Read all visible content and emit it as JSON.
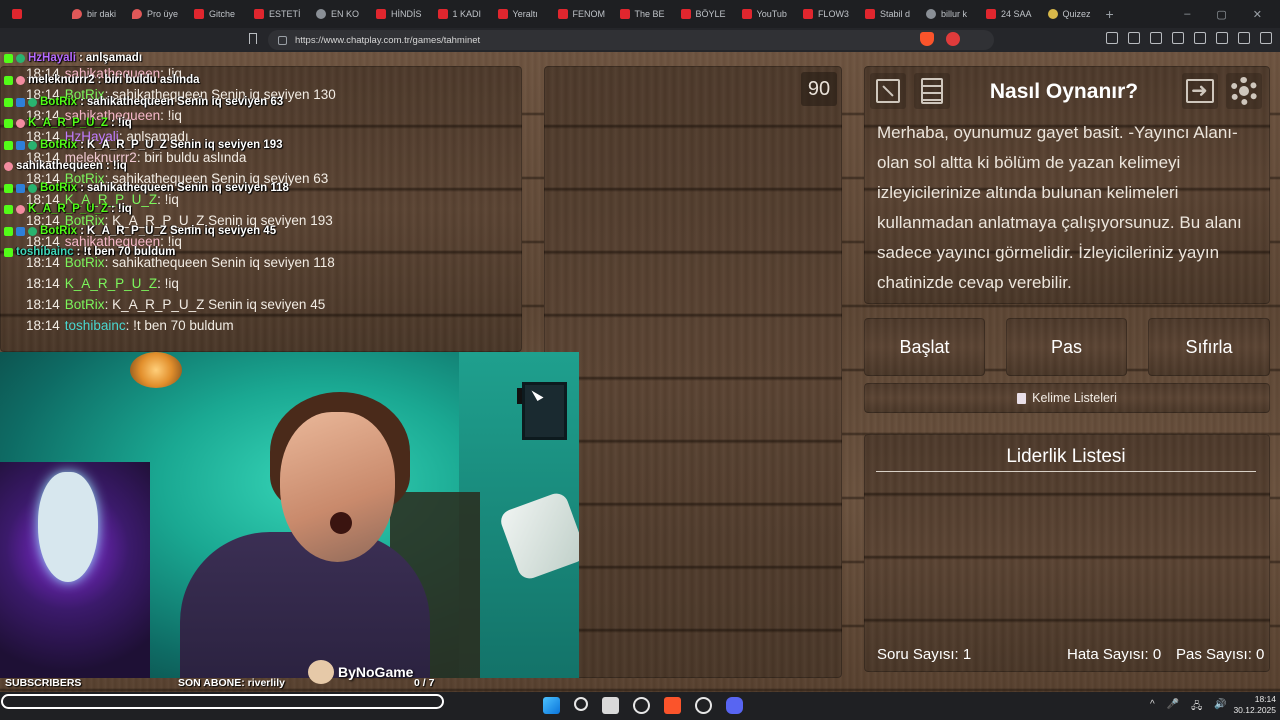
{
  "browser": {
    "tabs": [
      {
        "label": "",
        "icon": "kick-icon"
      },
      {
        "label": "bir daki",
        "icon": "pin-icon"
      },
      {
        "label": "Pro üye",
        "icon": "pin-icon"
      },
      {
        "label": "Gitche",
        "icon": "youtube-icon"
      },
      {
        "label": "ESTETİ",
        "icon": "youtube-icon"
      },
      {
        "label": "EN KO",
        "icon": "openai-icon"
      },
      {
        "label": "HİNDİS",
        "icon": "youtube-icon"
      },
      {
        "label": "1 KADI",
        "icon": "youtube-icon"
      },
      {
        "label": "Yeraltı",
        "icon": "youtube-icon"
      },
      {
        "label": "FENOM",
        "icon": "youtube-icon"
      },
      {
        "label": "The BE",
        "icon": "youtube-icon"
      },
      {
        "label": "BÖYLE",
        "icon": "youtube-icon"
      },
      {
        "label": "YouTub",
        "icon": "youtube-icon"
      },
      {
        "label": "FLOW3",
        "icon": "youtube-icon"
      },
      {
        "label": "Stabil d",
        "icon": "youtube-icon"
      },
      {
        "label": "billur k",
        "icon": "openai-icon"
      },
      {
        "label": "24 SAA",
        "icon": "youtube-icon"
      },
      {
        "label": "Quizez",
        "icon": "quiz-icon"
      }
    ],
    "new_tab": "+",
    "window_controls": [
      "–",
      "▢",
      "✕"
    ],
    "url": "https://www.chatplay.com.tr/games/tahminet"
  },
  "stream_overlay_chat": [
    {
      "user": "HzHayali",
      "message": "anlşamadı",
      "user_color": "purple",
      "badges": [
        "kick",
        "mod"
      ]
    },
    {
      "user": "meleknurrr2",
      "message": "biri buldu aslında",
      "user_color": "white",
      "badges": [
        "kick",
        "pink"
      ]
    },
    {
      "user": "BotRix",
      "message": "sahikathequeen Senin iq seviyen 63",
      "user_color": "green",
      "badges": [
        "kick",
        "blue",
        "mod"
      ]
    },
    {
      "user": "K_A_R_P_U_Z",
      "message": "!iq",
      "user_color": "green",
      "badges": [
        "kick",
        "pink"
      ]
    },
    {
      "user": "BotRix",
      "message": "K_A_R_P_U_Z Senin iq seviyen 193",
      "user_color": "green",
      "badges": [
        "kick",
        "blue",
        "mod"
      ]
    },
    {
      "user": "sahikathequeen",
      "message": "!iq",
      "user_color": "white",
      "badges": [
        "pink"
      ]
    },
    {
      "user": "BotRix",
      "message": "sahikathequeen Senin iq seviyen 118",
      "user_color": "green",
      "badges": [
        "kick",
        "blue",
        "mod"
      ]
    },
    {
      "user": "K_A_R_P_U_Z",
      "message": "!iq",
      "user_color": "green",
      "badges": [
        "kick",
        "pink"
      ]
    },
    {
      "user": "BotRix",
      "message": "K_A_R_P_U_Z Senin iq seviyen 45",
      "user_color": "green",
      "badges": [
        "kick",
        "blue",
        "mod"
      ]
    },
    {
      "user": "toshibainc",
      "message": "!t ben 70 buldum",
      "user_color": "teal",
      "badges": [
        "kick"
      ]
    }
  ],
  "game_chat": [
    {
      "time": "18:14",
      "user": "sahikathequeen",
      "message": "!iq",
      "color": "pink"
    },
    {
      "time": "18:14",
      "user": "BotRix",
      "message": "sahikathequeen Senin iq seviyen 130",
      "color": "green"
    },
    {
      "time": "18:14",
      "user": "sahikathequeen",
      "message": "!iq",
      "color": "pink"
    },
    {
      "time": "18:14",
      "user": "HzHayali",
      "message": "anlşamadı",
      "color": "purple"
    },
    {
      "time": "18:14",
      "user": "meleknurrr2",
      "message": "biri buldu aslında",
      "color": "mauve"
    },
    {
      "time": "18:14",
      "user": "BotRix",
      "message": "sahikathequeen Senin iq seviyen 63",
      "color": "green"
    },
    {
      "time": "18:14",
      "user": "K_A_R_P_U_Z",
      "message": "!iq",
      "color": "green"
    },
    {
      "time": "18:14",
      "user": "BotRix",
      "message": "K_A_R_P_U_Z Senin iq seviyen 193",
      "color": "green"
    },
    {
      "time": "18:14",
      "user": "sahikathequeen",
      "message": "!iq",
      "color": "pink"
    },
    {
      "time": "18:14",
      "user": "BotRix",
      "message": "sahikathequeen Senin iq seviyen 118",
      "color": "green"
    },
    {
      "time": "18:14",
      "user": "K_A_R_P_U_Z",
      "message": "!iq",
      "color": "green"
    },
    {
      "time": "18:14",
      "user": "BotRix",
      "message": "K_A_R_P_U_Z Senin iq seviyen 45",
      "color": "green"
    },
    {
      "time": "18:14",
      "user": "toshibainc",
      "message": "!t ben 70 buldum",
      "color": "teal"
    }
  ],
  "timer": "90",
  "howto": {
    "title": "Nasıl Oynanır?",
    "text": "Merhaba, oyunumuz gayet basit. -Yayıncı Alanı- olan sol altta ki bölüm de yazan kelimeyi izleyicilerinize altında bulunan kelimeleri kullanmadan anlatmaya çalışıyorsunuz. Bu alanı sadece yayıncı görmelidir. İzleyicileriniz yayın chatinizde cevap verebilir."
  },
  "actions": {
    "start": "Başlat",
    "pass": "Pas",
    "reset": "Sıfırla"
  },
  "word_lists": "Kelime Listeleri",
  "leaderboard": {
    "title": "Liderlik Listesi"
  },
  "stats": {
    "questions": "Soru Sayısı: 1",
    "errors": "Hata Sayısı: 0",
    "passes": "Pas Sayısı: 0"
  },
  "stream_footer": {
    "subscribers": "SUBSCRIBERS",
    "last_sub": "SON ABONE: riverlily",
    "channel": "ByNoGame",
    "progress": "0 / 7"
  },
  "taskbar": {
    "time": "18:14",
    "date": "30.12.2025",
    "tray": [
      "^",
      "🎤",
      "🖧",
      "🔊"
    ]
  },
  "colors": {
    "kick_green": "#53fc18",
    "bot_green": "#7cf55c",
    "wood_dark": "#4e3a2b",
    "brave": "#fb542b"
  }
}
